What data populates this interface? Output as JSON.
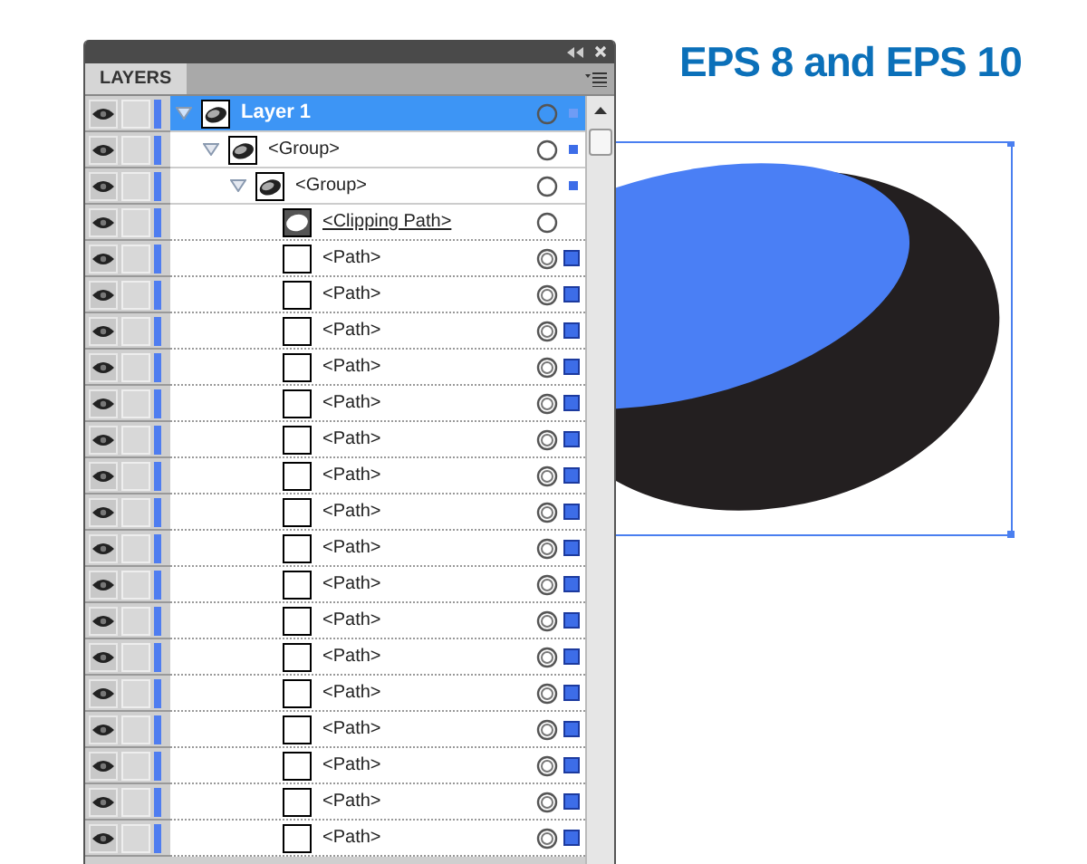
{
  "panel": {
    "tab": {
      "label": "LAYERS",
      "selected": true
    }
  },
  "layers": [
    {
      "name": "Layer 1",
      "kind": "layer",
      "selected": true,
      "expanded": true,
      "visible": true,
      "children": [
        {
          "name": "<Group>",
          "kind": "group",
          "selected": false,
          "expanded": true,
          "visible": true,
          "children": [
            {
              "name": "<Group>",
              "kind": "group",
              "selected": false,
              "expanded": true,
              "visible": true,
              "children": [
                {
                  "name": "<Clipping Path>",
                  "kind": "clip",
                  "selected": false,
                  "visible": true
                },
                {
                  "name": "<Path>",
                  "kind": "path",
                  "selected": false,
                  "visible": true
                },
                {
                  "name": "<Path>",
                  "kind": "path",
                  "selected": false,
                  "visible": true
                },
                {
                  "name": "<Path>",
                  "kind": "path",
                  "selected": false,
                  "visible": true
                },
                {
                  "name": "<Path>",
                  "kind": "path",
                  "selected": false,
                  "visible": true
                },
                {
                  "name": "<Path>",
                  "kind": "path",
                  "selected": false,
                  "visible": true
                },
                {
                  "name": "<Path>",
                  "kind": "path",
                  "selected": false,
                  "visible": true
                },
                {
                  "name": "<Path>",
                  "kind": "path",
                  "selected": false,
                  "visible": true
                },
                {
                  "name": "<Path>",
                  "kind": "path",
                  "selected": false,
                  "visible": true
                },
                {
                  "name": "<Path>",
                  "kind": "path",
                  "selected": false,
                  "visible": true
                },
                {
                  "name": "<Path>",
                  "kind": "path",
                  "selected": false,
                  "visible": true
                },
                {
                  "name": "<Path>",
                  "kind": "path",
                  "selected": false,
                  "visible": true
                },
                {
                  "name": "<Path>",
                  "kind": "path",
                  "selected": false,
                  "visible": true
                },
                {
                  "name": "<Path>",
                  "kind": "path",
                  "selected": false,
                  "visible": true
                },
                {
                  "name": "<Path>",
                  "kind": "path",
                  "selected": false,
                  "visible": true
                },
                {
                  "name": "<Path>",
                  "kind": "path",
                  "selected": false,
                  "visible": true
                },
                {
                  "name": "<Path>",
                  "kind": "path",
                  "selected": false,
                  "visible": true
                },
                {
                  "name": "<Path>",
                  "kind": "path",
                  "selected": false,
                  "visible": true
                }
              ]
            }
          ]
        }
      ]
    }
  ],
  "heading": "EPS 8 and EPS 10"
}
